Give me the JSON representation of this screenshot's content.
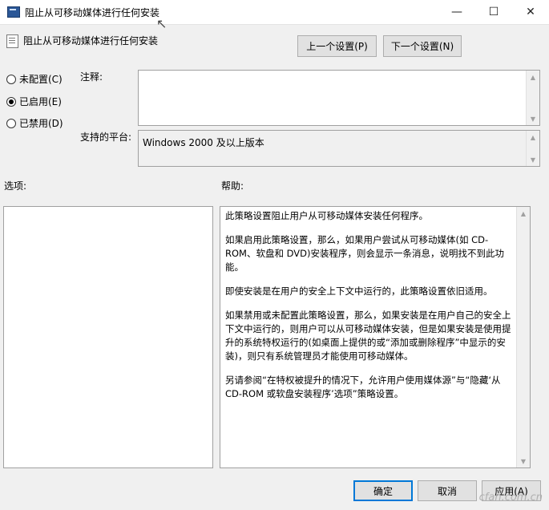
{
  "window": {
    "title": "阻止从可移动媒体进行任何安装",
    "minimize": "—",
    "maximize": "☐",
    "close": "✕"
  },
  "header": {
    "policy_title": "阻止从可移动媒体进行任何安装",
    "prev_button": "上一个设置(P)",
    "next_button": "下一个设置(N)"
  },
  "state": {
    "options": [
      {
        "label": "未配置(C)",
        "selected": false
      },
      {
        "label": "已启用(E)",
        "selected": true
      },
      {
        "label": "已禁用(D)",
        "selected": false
      }
    ]
  },
  "comment": {
    "label": "注释:",
    "value": ""
  },
  "platform": {
    "label": "支持的平台:",
    "value": "Windows 2000 及以上版本"
  },
  "options_section": {
    "label": "选项:"
  },
  "help_section": {
    "label": "帮助:",
    "paragraphs": [
      "此策略设置阻止用户从可移动媒体安装任何程序。",
      "如果启用此策略设置，那么，如果用户尝试从可移动媒体(如 CD-ROM、软盘和 DVD)安装程序，则会显示一条消息，说明找不到此功能。",
      "即使安装是在用户的安全上下文中运行的，此策略设置依旧适用。",
      "如果禁用或未配置此策略设置，那么，如果安装是在用户自己的安全上下文中运行的，则用户可以从可移动媒体安装，但是如果安装是使用提升的系统特权运行的(如桌面上提供的或“添加或删除程序”中显示的安装)，则只有系统管理员才能使用可移动媒体。",
      "另请参阅“在特权被提升的情况下，允许用户使用媒体源”与“隐藏‘从 CD-ROM 或软盘安装程序’选项”策略设置。"
    ]
  },
  "footer": {
    "ok": "确定",
    "cancel": "取消",
    "apply": "应用(A)"
  },
  "watermark": "cfan.com.cn",
  "colors": {
    "background": "#f0f0f0",
    "accent": "#0078d7"
  }
}
